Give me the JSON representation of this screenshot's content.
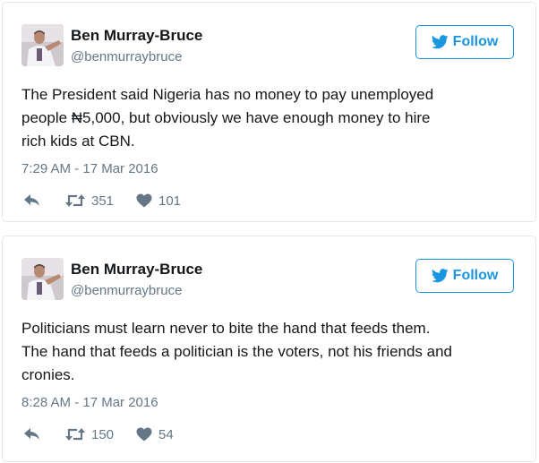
{
  "colors": {
    "accent": "#1b95e0",
    "secondary_text": "#657786",
    "border": "#e1e8ed"
  },
  "tweets": [
    {
      "author": {
        "name": "Ben Murray-Bruce",
        "handle": "@benmurraybruce",
        "avatar_icon": "profile-photo"
      },
      "follow_label": "Follow",
      "follow_icon": "twitter-bird-icon",
      "text_lines": [
        "The President said Nigeria has no money to pay unemployed",
        "people ₦5,000, but obviously we have enough money to hire",
        "rich kids at CBN."
      ],
      "timestamp": "7:29 AM - 17 Mar 2016",
      "actions": {
        "reply_icon": "reply-icon",
        "retweet_icon": "retweet-icon",
        "retweets": "351",
        "like_icon": "heart-icon",
        "likes": "101"
      }
    },
    {
      "author": {
        "name": "Ben Murray-Bruce",
        "handle": "@benmurraybruce",
        "avatar_icon": "profile-photo"
      },
      "follow_label": "Follow",
      "follow_icon": "twitter-bird-icon",
      "text_lines": [
        "Politicians must learn never to bite the hand that feeds them.",
        "The hand that feeds a politician is the voters, not his friends and",
        "cronies."
      ],
      "timestamp": "8:28 AM - 17 Mar 2016",
      "actions": {
        "reply_icon": "reply-icon",
        "retweet_icon": "retweet-icon",
        "retweets": "150",
        "like_icon": "heart-icon",
        "likes": "54"
      }
    }
  ]
}
